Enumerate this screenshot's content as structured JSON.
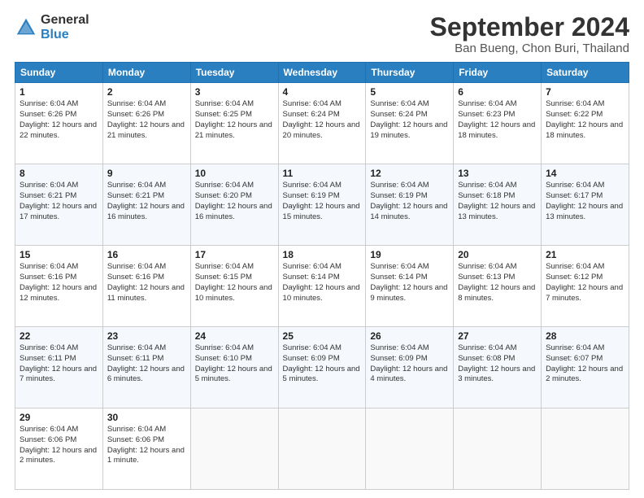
{
  "header": {
    "logo_general": "General",
    "logo_blue": "Blue",
    "month_title": "September 2024",
    "location": "Ban Bueng, Chon Buri, Thailand"
  },
  "days_of_week": [
    "Sunday",
    "Monday",
    "Tuesday",
    "Wednesday",
    "Thursday",
    "Friday",
    "Saturday"
  ],
  "weeks": [
    [
      {
        "day": "1",
        "sunrise": "Sunrise: 6:04 AM",
        "sunset": "Sunset: 6:26 PM",
        "daylight": "Daylight: 12 hours and 22 minutes."
      },
      {
        "day": "2",
        "sunrise": "Sunrise: 6:04 AM",
        "sunset": "Sunset: 6:26 PM",
        "daylight": "Daylight: 12 hours and 21 minutes."
      },
      {
        "day": "3",
        "sunrise": "Sunrise: 6:04 AM",
        "sunset": "Sunset: 6:25 PM",
        "daylight": "Daylight: 12 hours and 21 minutes."
      },
      {
        "day": "4",
        "sunrise": "Sunrise: 6:04 AM",
        "sunset": "Sunset: 6:24 PM",
        "daylight": "Daylight: 12 hours and 20 minutes."
      },
      {
        "day": "5",
        "sunrise": "Sunrise: 6:04 AM",
        "sunset": "Sunset: 6:24 PM",
        "daylight": "Daylight: 12 hours and 19 minutes."
      },
      {
        "day": "6",
        "sunrise": "Sunrise: 6:04 AM",
        "sunset": "Sunset: 6:23 PM",
        "daylight": "Daylight: 12 hours and 18 minutes."
      },
      {
        "day": "7",
        "sunrise": "Sunrise: 6:04 AM",
        "sunset": "Sunset: 6:22 PM",
        "daylight": "Daylight: 12 hours and 18 minutes."
      }
    ],
    [
      {
        "day": "8",
        "sunrise": "Sunrise: 6:04 AM",
        "sunset": "Sunset: 6:21 PM",
        "daylight": "Daylight: 12 hours and 17 minutes."
      },
      {
        "day": "9",
        "sunrise": "Sunrise: 6:04 AM",
        "sunset": "Sunset: 6:21 PM",
        "daylight": "Daylight: 12 hours and 16 minutes."
      },
      {
        "day": "10",
        "sunrise": "Sunrise: 6:04 AM",
        "sunset": "Sunset: 6:20 PM",
        "daylight": "Daylight: 12 hours and 16 minutes."
      },
      {
        "day": "11",
        "sunrise": "Sunrise: 6:04 AM",
        "sunset": "Sunset: 6:19 PM",
        "daylight": "Daylight: 12 hours and 15 minutes."
      },
      {
        "day": "12",
        "sunrise": "Sunrise: 6:04 AM",
        "sunset": "Sunset: 6:19 PM",
        "daylight": "Daylight: 12 hours and 14 minutes."
      },
      {
        "day": "13",
        "sunrise": "Sunrise: 6:04 AM",
        "sunset": "Sunset: 6:18 PM",
        "daylight": "Daylight: 12 hours and 13 minutes."
      },
      {
        "day": "14",
        "sunrise": "Sunrise: 6:04 AM",
        "sunset": "Sunset: 6:17 PM",
        "daylight": "Daylight: 12 hours and 13 minutes."
      }
    ],
    [
      {
        "day": "15",
        "sunrise": "Sunrise: 6:04 AM",
        "sunset": "Sunset: 6:16 PM",
        "daylight": "Daylight: 12 hours and 12 minutes."
      },
      {
        "day": "16",
        "sunrise": "Sunrise: 6:04 AM",
        "sunset": "Sunset: 6:16 PM",
        "daylight": "Daylight: 12 hours and 11 minutes."
      },
      {
        "day": "17",
        "sunrise": "Sunrise: 6:04 AM",
        "sunset": "Sunset: 6:15 PM",
        "daylight": "Daylight: 12 hours and 10 minutes."
      },
      {
        "day": "18",
        "sunrise": "Sunrise: 6:04 AM",
        "sunset": "Sunset: 6:14 PM",
        "daylight": "Daylight: 12 hours and 10 minutes."
      },
      {
        "day": "19",
        "sunrise": "Sunrise: 6:04 AM",
        "sunset": "Sunset: 6:14 PM",
        "daylight": "Daylight: 12 hours and 9 minutes."
      },
      {
        "day": "20",
        "sunrise": "Sunrise: 6:04 AM",
        "sunset": "Sunset: 6:13 PM",
        "daylight": "Daylight: 12 hours and 8 minutes."
      },
      {
        "day": "21",
        "sunrise": "Sunrise: 6:04 AM",
        "sunset": "Sunset: 6:12 PM",
        "daylight": "Daylight: 12 hours and 7 minutes."
      }
    ],
    [
      {
        "day": "22",
        "sunrise": "Sunrise: 6:04 AM",
        "sunset": "Sunset: 6:11 PM",
        "daylight": "Daylight: 12 hours and 7 minutes."
      },
      {
        "day": "23",
        "sunrise": "Sunrise: 6:04 AM",
        "sunset": "Sunset: 6:11 PM",
        "daylight": "Daylight: 12 hours and 6 minutes."
      },
      {
        "day": "24",
        "sunrise": "Sunrise: 6:04 AM",
        "sunset": "Sunset: 6:10 PM",
        "daylight": "Daylight: 12 hours and 5 minutes."
      },
      {
        "day": "25",
        "sunrise": "Sunrise: 6:04 AM",
        "sunset": "Sunset: 6:09 PM",
        "daylight": "Daylight: 12 hours and 5 minutes."
      },
      {
        "day": "26",
        "sunrise": "Sunrise: 6:04 AM",
        "sunset": "Sunset: 6:09 PM",
        "daylight": "Daylight: 12 hours and 4 minutes."
      },
      {
        "day": "27",
        "sunrise": "Sunrise: 6:04 AM",
        "sunset": "Sunset: 6:08 PM",
        "daylight": "Daylight: 12 hours and 3 minutes."
      },
      {
        "day": "28",
        "sunrise": "Sunrise: 6:04 AM",
        "sunset": "Sunset: 6:07 PM",
        "daylight": "Daylight: 12 hours and 2 minutes."
      }
    ],
    [
      {
        "day": "29",
        "sunrise": "Sunrise: 6:04 AM",
        "sunset": "Sunset: 6:06 PM",
        "daylight": "Daylight: 12 hours and 2 minutes."
      },
      {
        "day": "30",
        "sunrise": "Sunrise: 6:04 AM",
        "sunset": "Sunset: 6:06 PM",
        "daylight": "Daylight: 12 hours and 1 minute."
      },
      null,
      null,
      null,
      null,
      null
    ]
  ]
}
